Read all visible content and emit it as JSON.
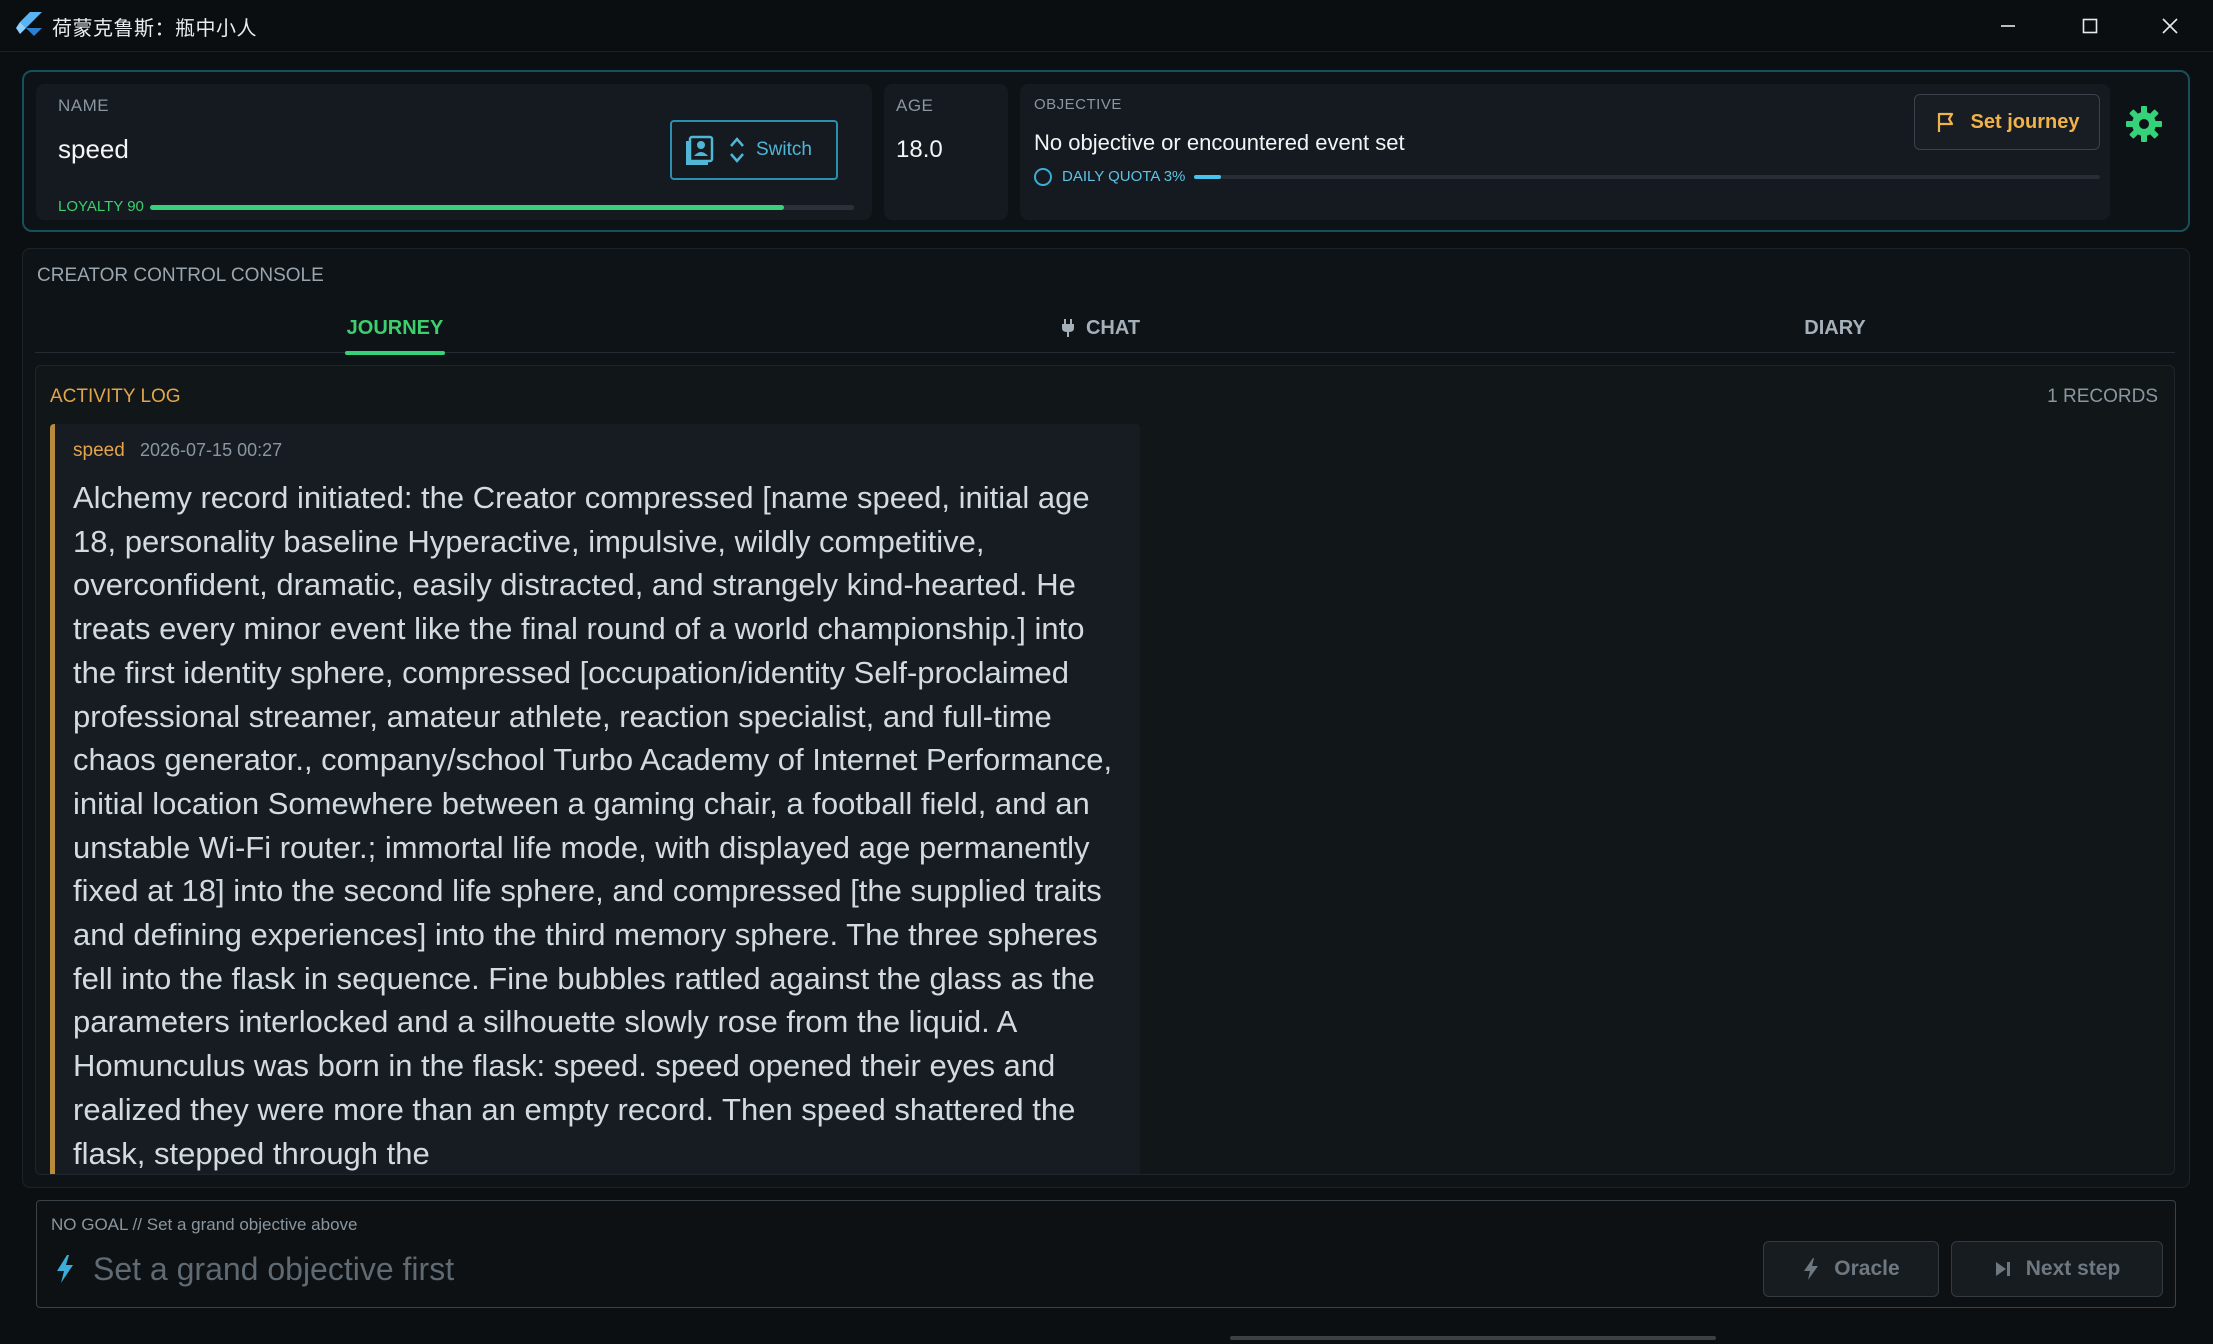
{
  "window": {
    "title": "荷蒙克鲁斯：瓶中小人",
    "minimize_icon": "minimize-icon",
    "maximize_icon": "maximize-icon",
    "close_icon": "close-icon"
  },
  "header": {
    "name_label": "NAME",
    "name_value": "speed",
    "switch_label": "Switch",
    "loyalty_label": "LOYALTY 90",
    "loyalty_value": 90,
    "age_label": "AGE",
    "age_value": "18.0",
    "objective_label": "OBJECTIVE",
    "objective_value": "No objective or encountered event set",
    "quota_label": "DAILY QUOTA 3%",
    "quota_value": 3,
    "set_journey_label": "Set journey"
  },
  "console": {
    "title": "CREATOR CONTROL CONSOLE",
    "tabs": [
      {
        "label": "JOURNEY",
        "active": true
      },
      {
        "label": "CHAT",
        "active": false,
        "icon": "plug-icon"
      },
      {
        "label": "DIARY",
        "active": false
      }
    ],
    "log": {
      "title": "ACTIVITY LOG",
      "count": "1 RECORDS",
      "entries": [
        {
          "author": "speed",
          "time": "2026-07-15 00:27",
          "text": "Alchemy record initiated: the Creator compressed [name speed, initial age 18, personality baseline Hyperactive, impulsive, wildly competitive, overconfident, dramatic, easily distracted, and strangely kind-hearted. He treats every minor event like the final round of a world championship.] into the first identity sphere, compressed [occupation/identity Self-proclaimed professional streamer, amateur athlete, reaction specialist, and full-time chaos generator., company/school Turbo Academy of Internet Performance, initial location Somewhere between a gaming chair, a football field, and an unstable Wi-Fi router.; immortal life mode, with displayed age permanently fixed at 18] into the second life sphere, and compressed [the supplied traits and defining experiences] into the third memory sphere. The three spheres fell into the flask in sequence. Fine bubbles rattled against the glass as the parameters interlocked and a silhouette slowly rose from the liquid. A Homunculus was born in the flask: speed. speed opened their eyes and realized they were more than an empty record. Then speed shattered the flask, stepped through the"
        }
      ]
    }
  },
  "composer": {
    "hint": "NO GOAL // Set a grand objective above",
    "placeholder": "Set a grand objective first",
    "oracle_label": "Oracle",
    "next_label": "Next step"
  },
  "colors": {
    "accent_green": "#35d27a",
    "accent_cyan": "#46c3ee",
    "accent_amber": "#e3a44c"
  }
}
